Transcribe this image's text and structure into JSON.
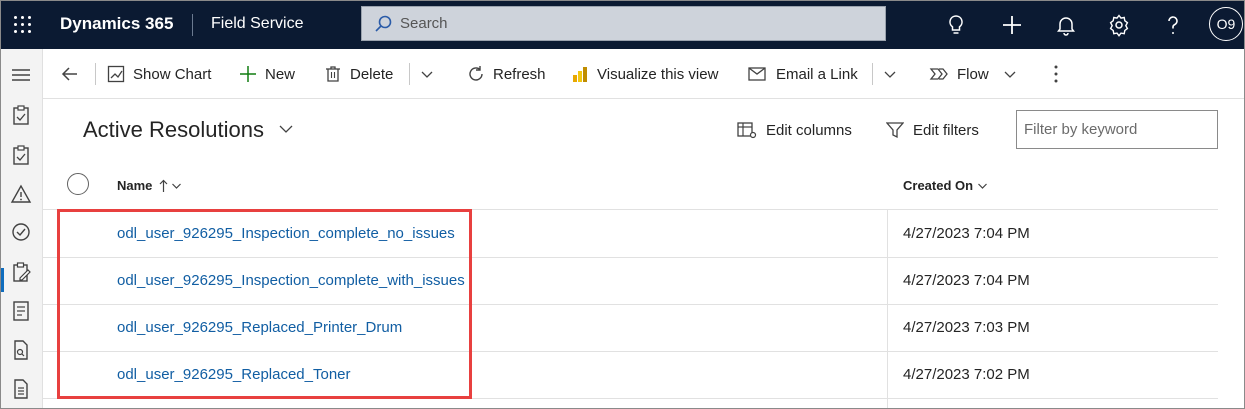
{
  "topbar": {
    "brand": "Dynamics 365",
    "app_name": "Field Service",
    "search_placeholder": "Search",
    "user_initials": "O9"
  },
  "commands": {
    "show_chart": "Show Chart",
    "new": "New",
    "delete": "Delete",
    "refresh": "Refresh",
    "visualize": "Visualize this view",
    "email_link": "Email a Link",
    "flow": "Flow"
  },
  "view": {
    "title": "Active Resolutions",
    "edit_columns": "Edit columns",
    "edit_filters": "Edit filters",
    "filter_placeholder": "Filter by keyword"
  },
  "grid": {
    "columns": {
      "name": "Name",
      "created_on": "Created On"
    },
    "rows": [
      {
        "name": "odl_user_926295_Inspection_complete_no_issues",
        "created_on": "4/27/2023 7:04 PM"
      },
      {
        "name": "odl_user_926295_Inspection_complete_with_issues",
        "created_on": "4/27/2023 7:04 PM"
      },
      {
        "name": "odl_user_926295_Replaced_Printer_Drum",
        "created_on": "4/27/2023 7:03 PM"
      },
      {
        "name": "odl_user_926295_Replaced_Toner",
        "created_on": "4/27/2023 7:02 PM"
      }
    ]
  },
  "colors": {
    "topbar_bg": "#0b1a32",
    "link": "#115ea3",
    "highlight": "#e8403f",
    "accent": "#0f6cbd"
  },
  "rail_icons": [
    "menu-icon",
    "clipboard-icon",
    "clipboard-icon",
    "warning-icon",
    "check-circle-icon",
    "clipboard-edit-icon",
    "checklist-icon",
    "document-search-icon",
    "document-icon"
  ]
}
